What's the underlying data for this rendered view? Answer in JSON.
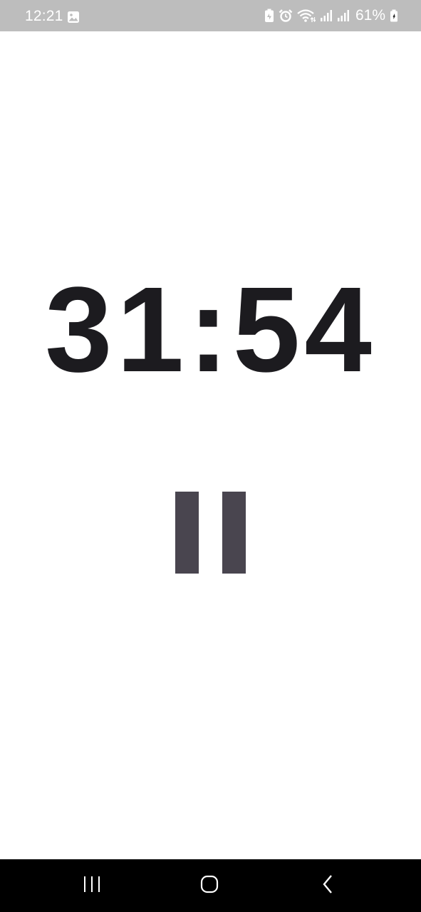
{
  "status_bar": {
    "time": "12:21",
    "battery": "61%",
    "icons": [
      "gallery-icon",
      "battery-saver-icon",
      "alarm-icon",
      "wifi-icon",
      "signal-icon",
      "signal-icon",
      "battery-icon"
    ]
  },
  "timer": {
    "display": "31:54"
  },
  "controls": {
    "pause_icon": "pause-icon",
    "pause_color": "#49454f"
  },
  "nav_bar": {
    "buttons": [
      "recents-icon",
      "home-icon",
      "back-icon"
    ]
  },
  "colors": {
    "status_bar_bg": "#bdbdbd",
    "timer_text": "#1c1b1f",
    "background": "#ffffff",
    "nav_bar_bg": "#000000"
  }
}
